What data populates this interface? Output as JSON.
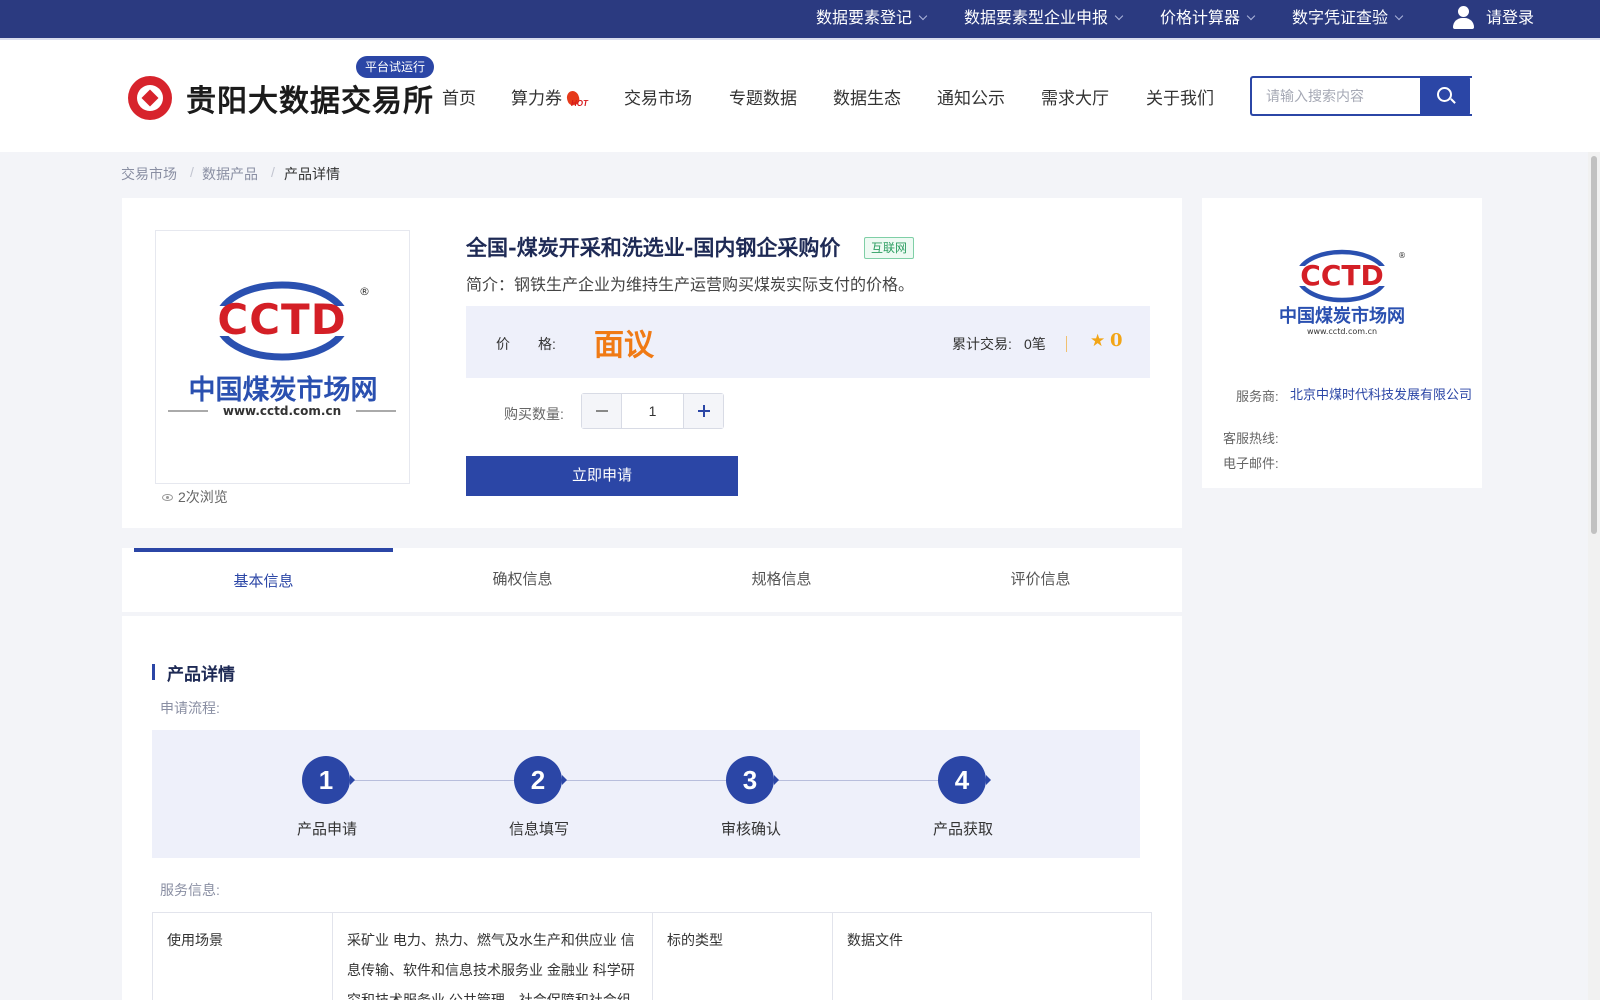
{
  "topbar": {
    "items": [
      "数据要素登记",
      "数据要素型企业申报",
      "价格计算器",
      "数字凭证查验"
    ],
    "login": "请登录"
  },
  "header": {
    "logo_text": "贵阳大数据交易所",
    "trial_badge": "平台试运行",
    "nav": [
      "首页",
      "算力券",
      "交易市场",
      "专题数据",
      "数据生态",
      "通知公示",
      "需求大厅",
      "关于我们"
    ],
    "hot_badge": "HOT",
    "search_placeholder": "请输入搜索内容"
  },
  "breadcrumb": [
    "交易市场",
    "数据产品",
    "产品详情"
  ],
  "product": {
    "image_logo": "CCTD",
    "image_name": "中国煤炭市场网",
    "image_url": "www.cctd.com.cn",
    "views": "2次浏览",
    "title": "全国-煤炭开采和洗选业-国内钢企采购价",
    "tag": "互联网",
    "intro": "简介：钢铁生产企业为维持生产运营购买煤炭实际支付的价格。",
    "price_label": "价　　格:",
    "price_value": "面议",
    "trade_label": "累计交易:",
    "trade_value": "0笔",
    "star_count": "0",
    "qty_label": "购买数量:",
    "qty_value": "1",
    "apply_button": "立即申请"
  },
  "provider": {
    "logo": "CCTD",
    "name_cn": "中国煤炭市场网",
    "url": "www.cctd.com.cn",
    "service_label": "服务商:",
    "service_value": "北京中煤时代科技发展有限公司",
    "hotline_label": "客服热线:",
    "email_label": "电子邮件:"
  },
  "tabs": [
    "基本信息",
    "确权信息",
    "规格信息",
    "评价信息"
  ],
  "detail": {
    "section_title": "产品详情",
    "process_label": "申请流程:",
    "steps": [
      {
        "num": "1",
        "label": "产品申请"
      },
      {
        "num": "2",
        "label": "信息填写"
      },
      {
        "num": "3",
        "label": "审核确认"
      },
      {
        "num": "4",
        "label": "产品获取"
      }
    ],
    "service_label": "服务信息:",
    "service_table": {
      "scene_label": "使用场景",
      "scene_value": "采矿业 电力、热力、燃气及水生产和供应业 信息传输、软件和信息技术服务业 金融业 科学研究和技术服务业 公共管理、社会保障和社会组",
      "type_label": "标的类型",
      "type_value": "数据文件"
    }
  },
  "colors": {
    "primary": "#2b46a6",
    "topbar": "#2b3a80",
    "price": "#f07a14",
    "star": "#f2a516",
    "logo_red": "#d7232c"
  }
}
